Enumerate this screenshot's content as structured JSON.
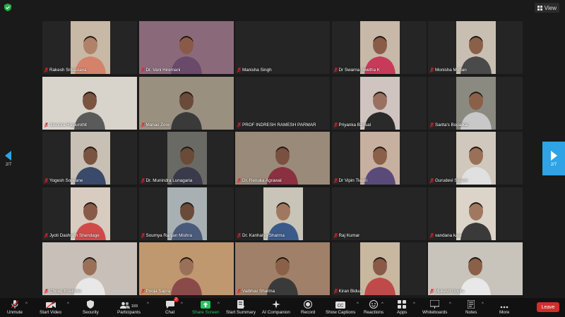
{
  "topbar": {
    "view_label": "View",
    "security_icon": "shield-check-icon",
    "accent": "#2ea3e6"
  },
  "pagination": {
    "left_label": "2/7",
    "right_label": "2/7"
  },
  "participants": [
    {
      "name": "Rakesh Srivastava",
      "video": true
    },
    {
      "name": "Dr. Vani Hiremani",
      "video": true
    },
    {
      "name": "Manisha Singh",
      "video": false
    },
    {
      "name": "Dr Swarna  Swetha K",
      "video": true
    },
    {
      "name": "Monisha Mohan",
      "video": true
    },
    {
      "name": "Jitendra Rajpurohit",
      "video": true
    },
    {
      "name": "Manas Zore",
      "video": true
    },
    {
      "name": "PROF INDRESH RAMESH PARMAR",
      "video": false
    },
    {
      "name": "Priyanka Bansal",
      "video": true
    },
    {
      "name": "Sarita's Bopalkar",
      "video": true
    },
    {
      "name": "Yogesh Sonvane",
      "video": true
    },
    {
      "name": "Dr. Munindra Lunagaria",
      "video": true
    },
    {
      "name": "Dr. Renuka Agrawal",
      "video": true
    },
    {
      "name": "Dr Vipin Tiwari",
      "video": true
    },
    {
      "name": "Gurudevi Swami",
      "video": true
    },
    {
      "name": "Jyoti Dashrath Shendage",
      "video": true
    },
    {
      "name": "Soumya Ranjan Mishra",
      "video": true
    },
    {
      "name": "Dr. Kanhaiya Sharma",
      "video": true
    },
    {
      "name": "Raj Kumar",
      "video": false
    },
    {
      "name": "vandana kate",
      "video": true
    },
    {
      "name": "Chirag Bhalodia",
      "video": true
    },
    {
      "name": "Pooja Sapra",
      "video": true
    },
    {
      "name": "Vaibhav Sharma",
      "video": true
    },
    {
      "name": "Kiran Bidua",
      "video": true
    },
    {
      "name": "Mukesh Gupta",
      "video": true
    }
  ],
  "toolbar": {
    "unmute": "Unmute",
    "start_video": "Start Video",
    "security": "Security",
    "participants": "Participants",
    "participants_count": "169",
    "chat": "Chat",
    "chat_badge": "2",
    "share_screen": "Share Screen",
    "start_summary": "Start Summary",
    "ai_companion": "AI Companion",
    "record": "Record",
    "show_captions": "Show Captions",
    "reactions": "Reactions",
    "apps": "Apps",
    "whiteboards": "Whiteboards",
    "notes": "Notes",
    "more": "More",
    "leave": "Leave",
    "share_color": "#22c55e",
    "leave_color": "#d12d2d"
  }
}
